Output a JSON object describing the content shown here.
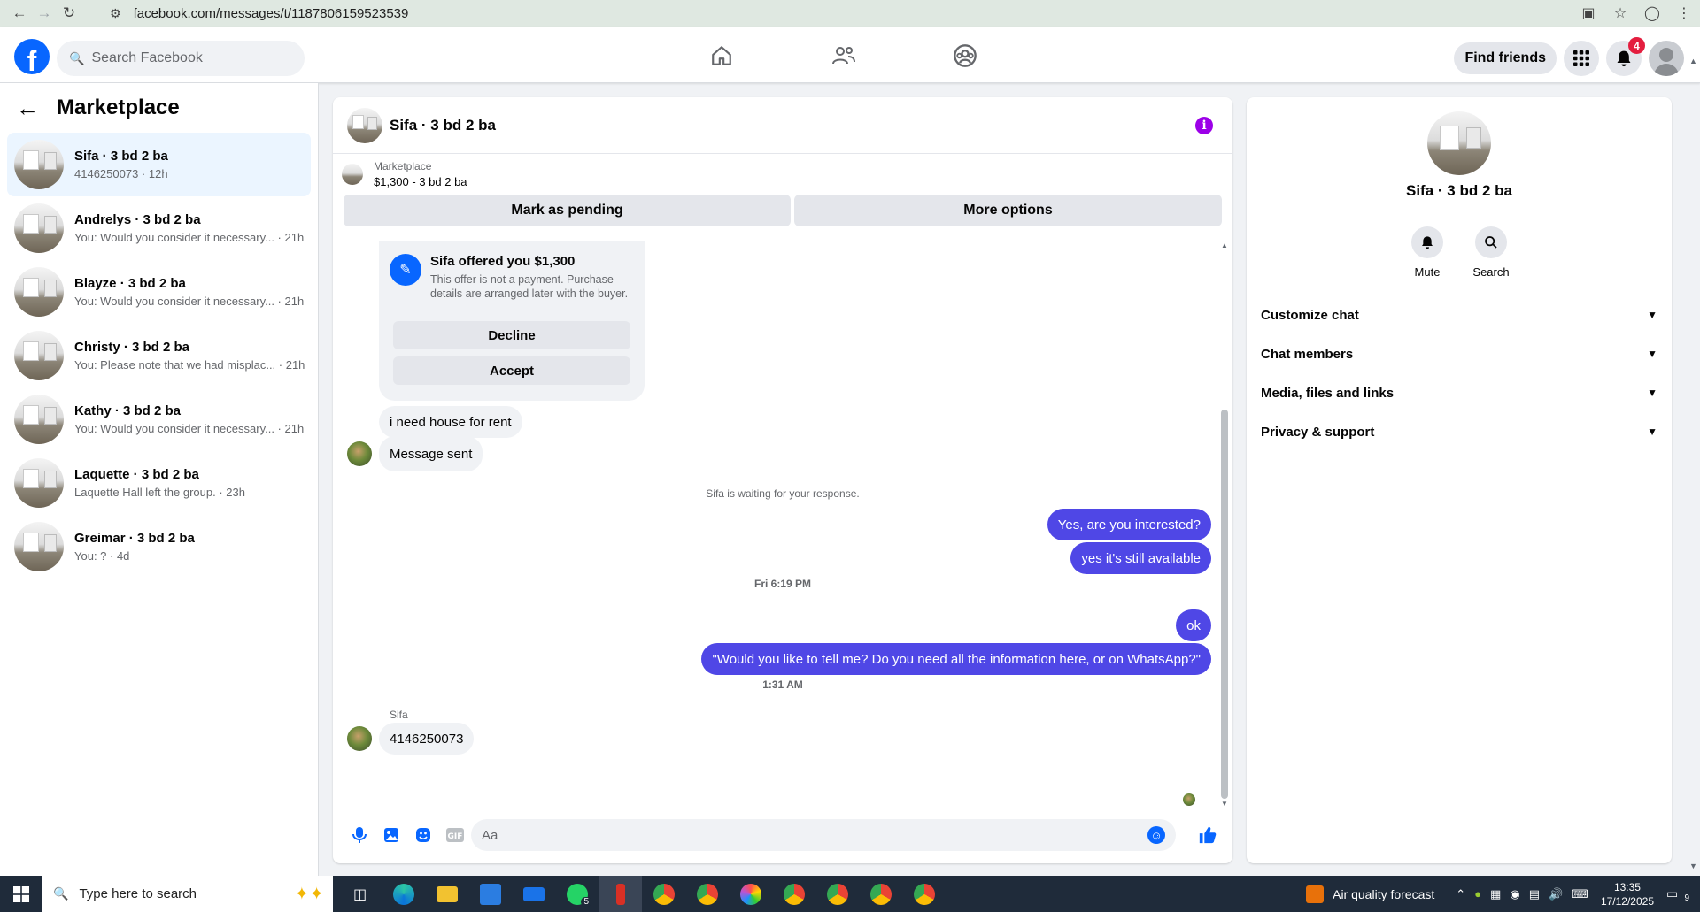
{
  "browser": {
    "url": "facebook.com/messages/t/1187806159523539"
  },
  "header": {
    "search_placeholder": "Search Facebook",
    "find_friends": "Find friends",
    "notification_count": "4"
  },
  "sidebar": {
    "title": "Marketplace",
    "conversations": [
      {
        "name": "Sifa · 3 bd 2 ba",
        "preview": "4146250073 · 12h",
        "active": true
      },
      {
        "name": "Andrelys · 3 bd 2 ba",
        "preview": "You: Would you consider it necessary... · 21h"
      },
      {
        "name": "Blayze · 3 bd 2 ba",
        "preview": "You: Would you consider it necessary... · 21h"
      },
      {
        "name": "Christy · 3 bd 2 ba",
        "preview": "You: Please note that we had misplac... · 21h"
      },
      {
        "name": "Kathy · 3 bd 2 ba",
        "preview": "You: Would you consider it necessary... · 21h"
      },
      {
        "name": "Laquette · 3 bd 2 ba",
        "preview": "Laquette Hall left the group. · 23h"
      },
      {
        "name": "Greimar · 3 bd 2 ba",
        "preview": "You: ? · 4d"
      }
    ]
  },
  "chat": {
    "title": "Sifa · 3 bd 2 ba",
    "listing_label": "Marketplace",
    "listing_price": "$1,300 - 3 bd 2 ba",
    "mark_pending": "Mark as pending",
    "more_options": "More options",
    "offer": {
      "title": "Sifa offered you $1,300",
      "description": "This offer is not a payment. Purchase details are arranged later with the buyer.",
      "decline": "Decline",
      "accept": "Accept"
    },
    "messages": {
      "in_1": "i need house for rent",
      "in_2": "Message sent",
      "waiting_note": "Sifa is waiting for your response.",
      "out_1": "Yes, are you interested?",
      "out_2": "yes it's still available",
      "time_1": "Fri 6:19 PM",
      "out_3": "ok",
      "out_4": "\"Would you like to tell me? Do you need all the information here, or on WhatsApp?\"",
      "time_2": "1:31 AM",
      "sender_label": "Sifa",
      "in_3": "4146250073"
    },
    "composer_placeholder": "Aa"
  },
  "right_panel": {
    "name": "Sifa · 3 bd 2 ba",
    "mute": "Mute",
    "search": "Search",
    "sections": [
      "Customize chat",
      "Chat members",
      "Media, files and links",
      "Privacy & support"
    ]
  },
  "taskbar": {
    "search_placeholder": "Type here to search",
    "whatsapp_badge": "5",
    "air_quality": "Air quality forecast",
    "time": "13:35",
    "date": "17/12/2025",
    "notification_count": "9"
  }
}
